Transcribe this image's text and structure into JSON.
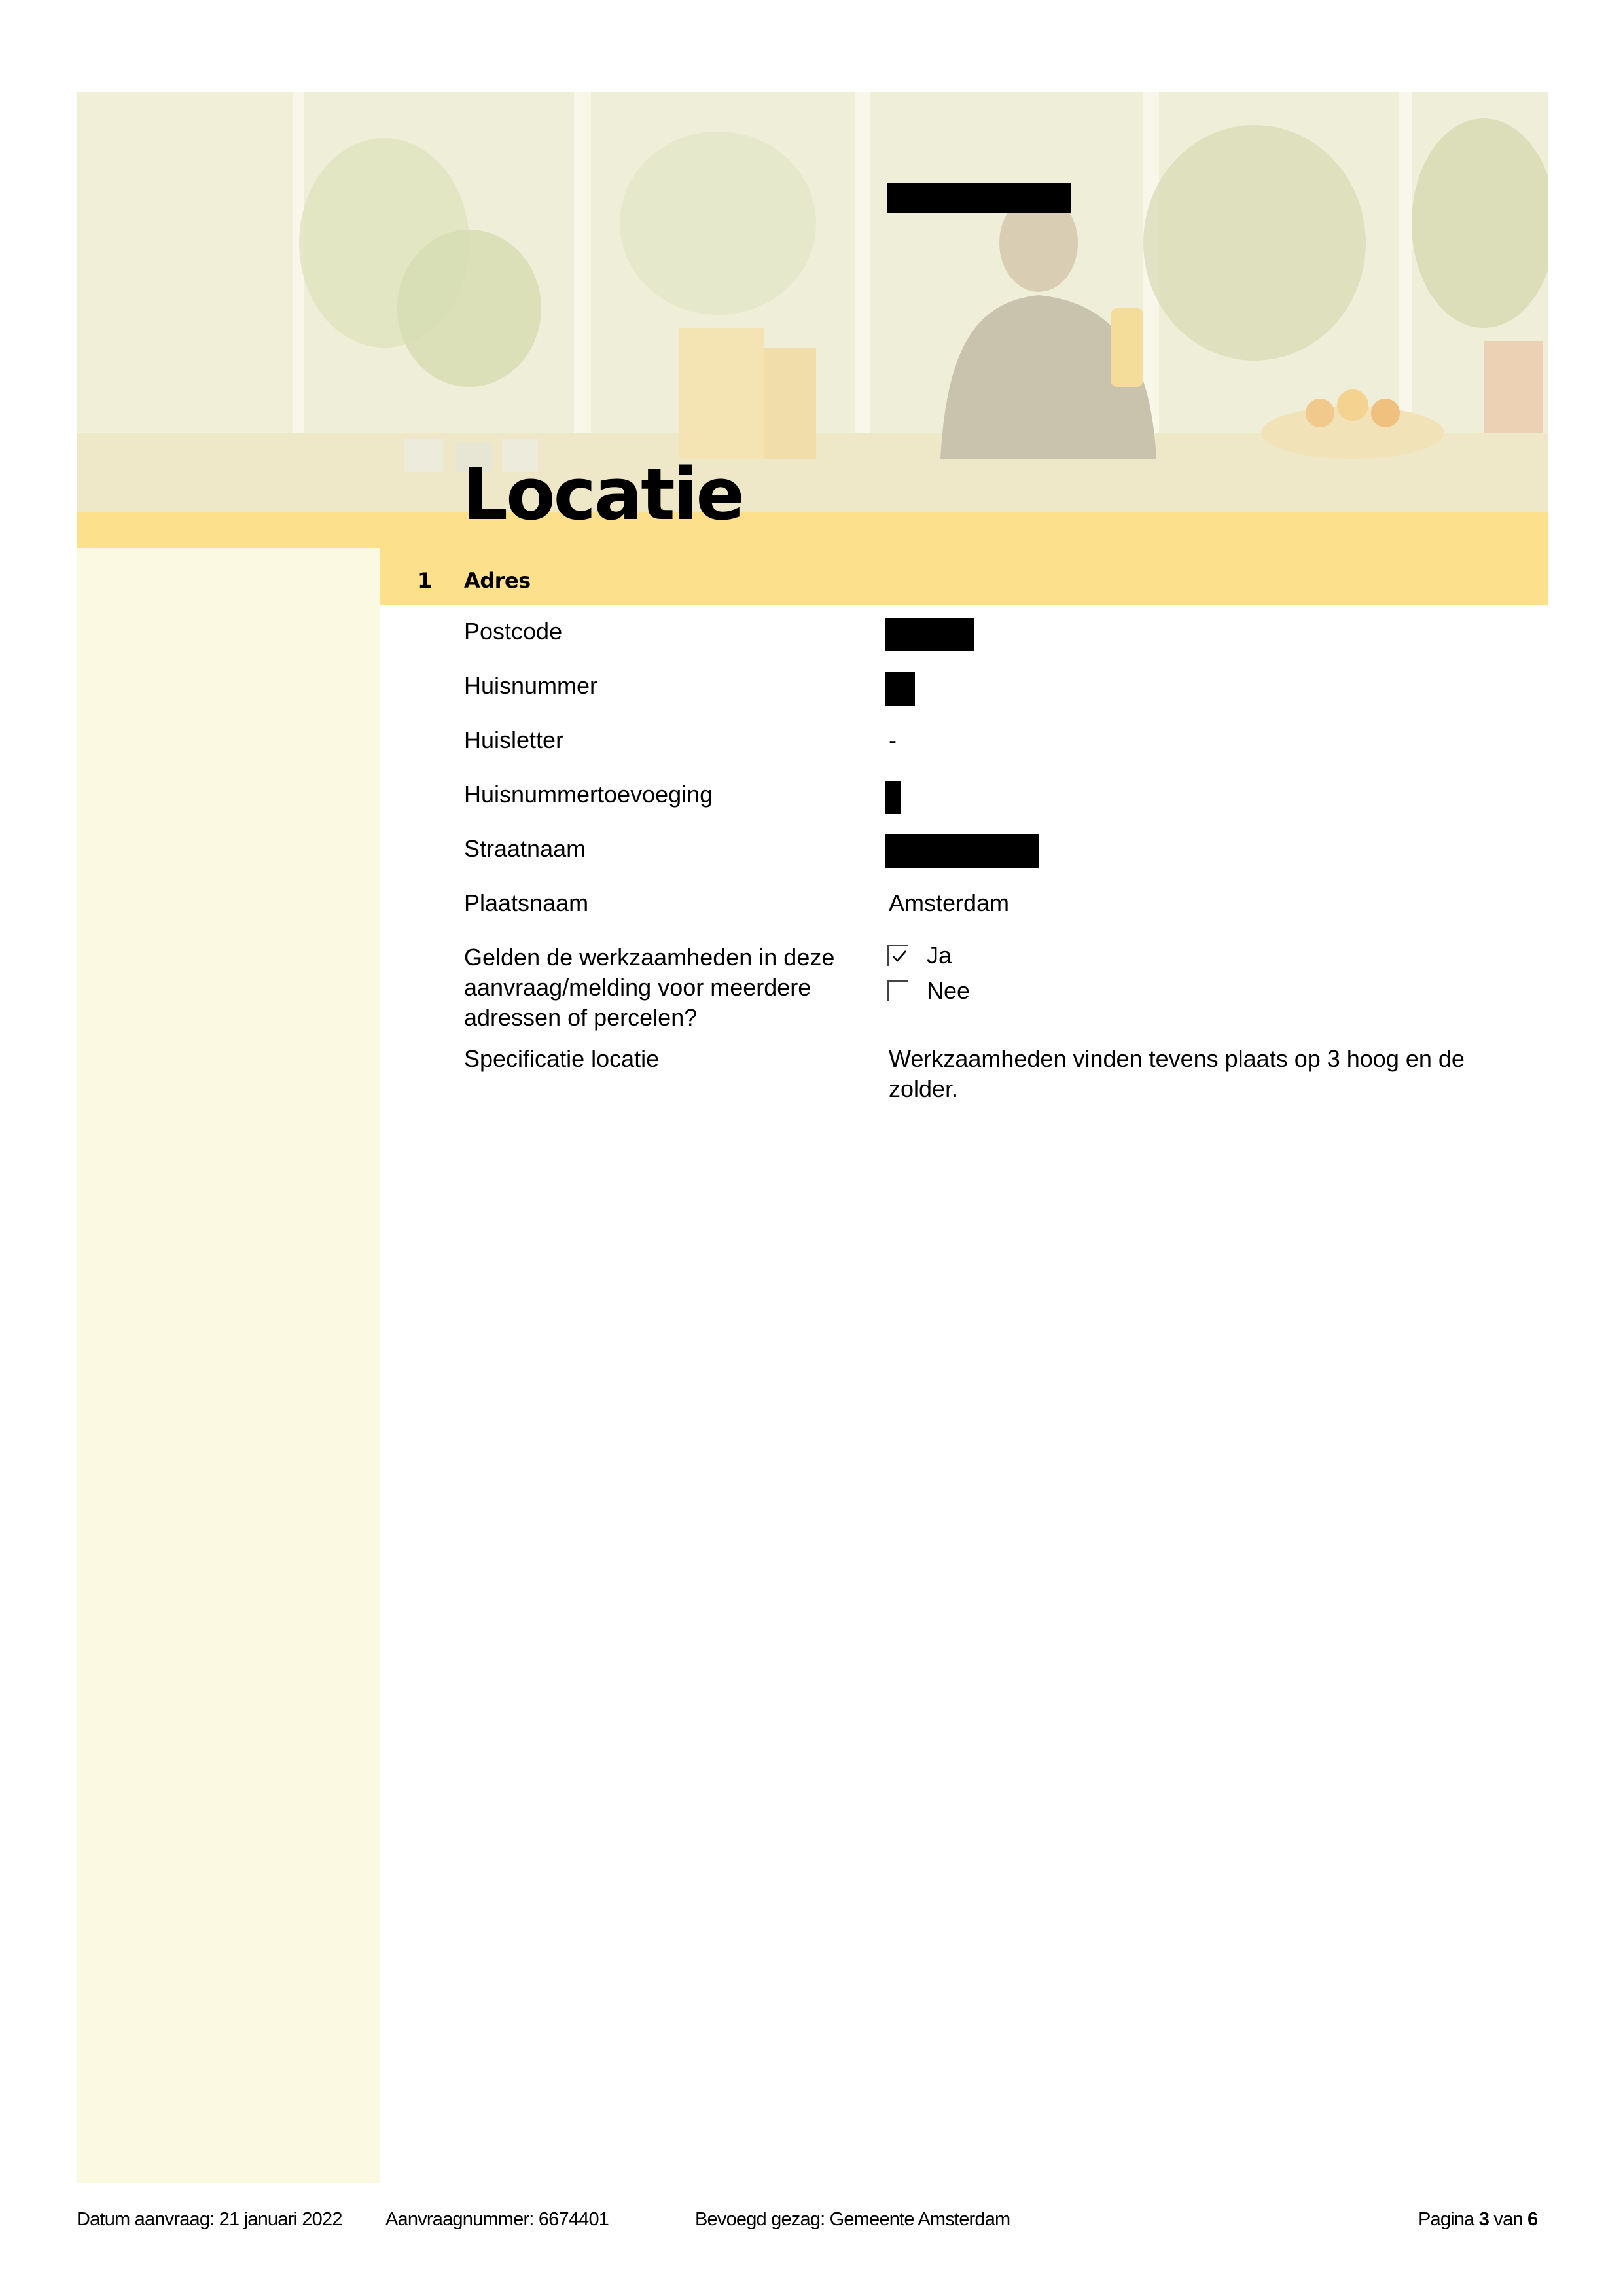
{
  "header": {
    "title": "Locatie"
  },
  "section": {
    "number": "1",
    "title": "Adres"
  },
  "fields": {
    "postcode": {
      "label": "Postcode"
    },
    "huisnummer": {
      "label": "Huisnummer"
    },
    "huisletter": {
      "label": "Huisletter",
      "value": "-"
    },
    "huisnummertoevoeging": {
      "label": "Huisnummertoevoeging"
    },
    "straatnaam": {
      "label": "Straatnaam"
    },
    "plaatsnaam": {
      "label": "Plaatsnaam",
      "value": "Amsterdam"
    },
    "meerdere_adressen": {
      "label": "Gelden de werkzaamheden in deze aanvraag/melding voor meerdere adressen of percelen?",
      "options": [
        {
          "label": "Ja",
          "checked": true
        },
        {
          "label": "Nee",
          "checked": false
        }
      ]
    },
    "specificatie": {
      "label": "Specificatie locatie",
      "value": "Werkzaamheden vinden tevens plaats op 3 hoog en de zolder."
    }
  },
  "footer": {
    "datum": "Datum aanvraag: 21 januari 2022",
    "aanvraagnummer": "Aanvraagnummer: 6674401",
    "bevoegd_gezag": "Bevoegd gezag: Gemeente Amsterdam",
    "pagina_prefix": "Pagina",
    "pagina_current": "3",
    "pagina_mid": "van",
    "pagina_total": "6"
  },
  "colors": {
    "band_yellow": "#fde08c",
    "sidebar_cream": "#fbf9e2",
    "redaction": "#000000"
  }
}
